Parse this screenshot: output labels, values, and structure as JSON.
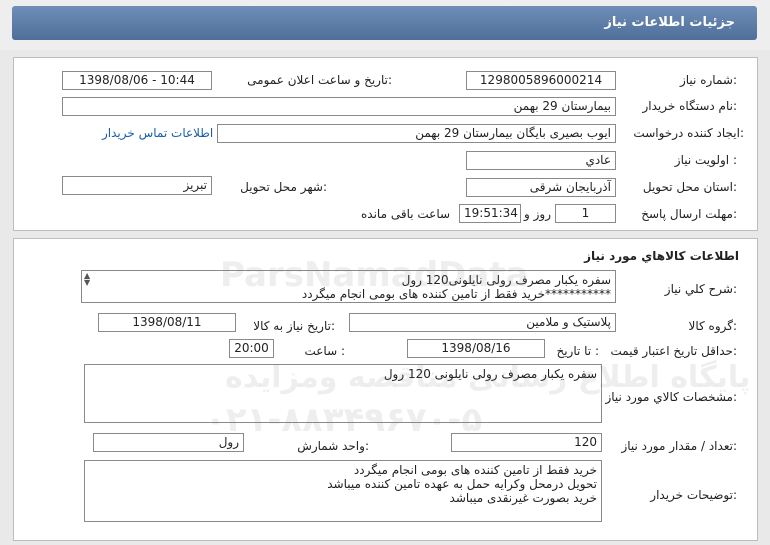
{
  "header": {
    "title": "جزئیات اطلاعات نیاز"
  },
  "need_info": {
    "need_number_label": "شماره نیاز:",
    "need_number": "1298005896000214",
    "announce_label": "تاریخ و ساعت اعلان عمومی:",
    "announce_value": "1398/08/06 - 10:44",
    "buyer_org_label": "نام دستگاه خریدار:",
    "buyer_org": "بیمارستان 29 بهمن",
    "creator_label": "ایجاد کننده درخواست:",
    "creator": "ایوب بصیری  بایگان بیمارستان 29 بهمن",
    "contact_link": "اطلاعات تماس خریدار",
    "priority_label": "اولویت نیاز :",
    "priority": "عادي",
    "province_label": "استان محل تحویل:",
    "province": "آذربایجان شرقی",
    "city_label": "شهر محل تحویل:",
    "city": "تبریز",
    "deadline_label": "مهلت ارسال پاسخ:",
    "days": "1",
    "days_suffix": "روز و",
    "time_left": "19:51:34",
    "time_suffix": "ساعت باقی مانده"
  },
  "goods": {
    "section_title": "اطلاعات کالاهاي مورد نياز",
    "general_desc_label": "شرح کلي نياز:",
    "general_desc_line1": "سفره یکبار مصرف رولی نایلونی120 رول",
    "general_desc_line2": "***********خرید فقط از تامین کننده های بومی انجام میگردد",
    "group_label": "گروه کالا:",
    "group": "پلاستیک و ملامین",
    "need_date_label": "تاریخ نیاز به کالا:",
    "need_date": "1398/08/11",
    "price_validity_label": "حداقل تاریخ اعتبار قیمت:",
    "until_date_label": "تا تاریخ :",
    "until_date": "1398/08/16",
    "hour_label": "ساعت :",
    "hour": "20:00",
    "spec_label": "مشخصات کالاي مورد نياز:",
    "spec": "سفره یکبار مصرف رولی نایلونی 120 رول",
    "qty_label": "تعداد / مقدار مورد نياز:",
    "qty": "120",
    "unit_label": "واحد شمارش:",
    "unit": "رول",
    "buyer_notes_label": "توضيحات خريدار:",
    "notes": [
      "خرید فقط از تامین کننده های بومی انجام میگردد",
      "تحویل درمحل وکرایه حمل به عهده تامین کننده میباشد",
      "خرید بصورت غیرنقدی میباشد"
    ]
  },
  "watermark": {
    "brand": "ParsNamadData",
    "line1": "پایگاه اطلاع رسانی مناقصه ومزایده",
    "phone": "۰۲۱-۸۸۳۴۹۶۷۰-۵"
  }
}
